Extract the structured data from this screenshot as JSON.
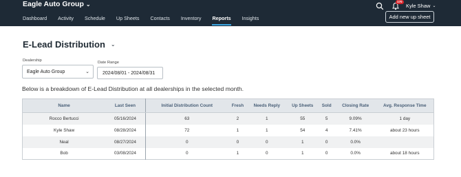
{
  "header": {
    "brand": "Eagle Auto Group",
    "nav": [
      "Dashboard",
      "Activity",
      "Schedule",
      "Up Sheets",
      "Contacts",
      "Inventory",
      "Reports",
      "Insights"
    ],
    "active_nav": "Reports",
    "notification_count": "170",
    "user_name": "Kyle Shaw",
    "add_button": "Add new up sheet"
  },
  "page": {
    "title": "E-Lead Distribution",
    "dealership_label": "Dealership",
    "dealership_value": "Eagle Auto Group",
    "date_range_label": "Date Range",
    "date_range_value": "2024/08/01 - 2024/08/31",
    "description": "Below is a breakdown of E-Lead Distribution at all dealerships in the selected month."
  },
  "table": {
    "columns": [
      "Name",
      "Last Seen",
      "Initial Distribution Count",
      "Fresh",
      "Needs Reply",
      "Up Sheets",
      "Sold",
      "Closing Rate",
      "Avg. Response Time"
    ],
    "rows": [
      [
        "Rocco Bertucci",
        "05/16/2024",
        "63",
        "2",
        "1",
        "55",
        "5",
        "9.09%",
        "1 day"
      ],
      [
        "Kyle Shaw",
        "08/28/2024",
        "72",
        "1",
        "1",
        "54",
        "4",
        "7.41%",
        "about 23 hours"
      ],
      [
        "Neal",
        "08/27/2024",
        "0",
        "0",
        "0",
        "1",
        "0",
        "0.0%",
        ""
      ],
      [
        "Bob",
        "03/08/2024",
        "0",
        "1",
        "0",
        "1",
        "0",
        "0.0%",
        "about 18 hours"
      ]
    ]
  },
  "colors": {
    "nav_bg": "#1e2a36",
    "accent": "#3aa5e0",
    "link": "#2e6fb0",
    "badge": "#d9262c"
  }
}
